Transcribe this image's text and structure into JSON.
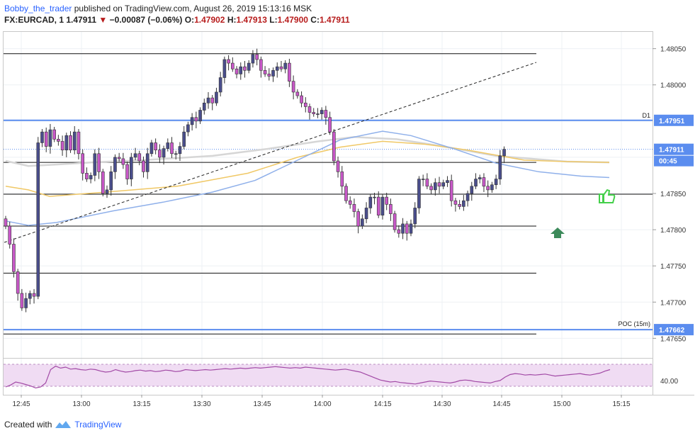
{
  "header": {
    "author": "Bobby_the_trader",
    "published": "published on TradingView.com, August 26, 2019 15:13:16 MSK",
    "symbol": "FX:EURCAD, 1",
    "price": "1.47911",
    "change": "−0.00087 (−0.06%)",
    "o_label": "O:",
    "o": "1.47902",
    "h_label": "H:",
    "h": "1.47913",
    "l_label": "L:",
    "l": "1.47900",
    "c_label": "C:",
    "c": "1.47911"
  },
  "footer": {
    "created_with": "Created with",
    "brand": "TradingView"
  },
  "price_axis": {
    "ticks": [
      "1.48050",
      "1.48000",
      "1.47850",
      "1.47800",
      "1.47750",
      "1.47700",
      "1.47650"
    ],
    "range": [
      1.4762,
      1.4808
    ]
  },
  "time_axis": {
    "ticks": [
      "12:45",
      "13:00",
      "13:15",
      "13:30",
      "13:45",
      "14:00",
      "14:15",
      "14:30",
      "14:45",
      "15:00",
      "15:15"
    ]
  },
  "tags": {
    "d1_label": "D1",
    "d1_value": "1.47951",
    "current_value": "1.47911",
    "countdown": "00:45",
    "poc_label": "POC (15m)",
    "poc_value": "1.47662"
  },
  "rsi": {
    "tick": "40.00"
  },
  "colors": {
    "bull": "#4a4e8c",
    "bear": "#c858c8",
    "blue_line": "#5b8def",
    "ma_blue": "#8fb0ea",
    "ma_yellow": "#f0c866",
    "ma_gray": "#d6d6d6",
    "rsi_line": "#a24aa6",
    "rsi_band": "#f0dcf3",
    "arrow": "#3c8a5a",
    "thumb": "#44d04a"
  },
  "chart_data": {
    "type": "candlestick",
    "symbol": "EURCAD",
    "interval": "1",
    "ylim": [
      1.4762,
      1.4808
    ],
    "horizontal_levels": [
      1.48043,
      1.47951,
      1.47893,
      1.47849,
      1.47805,
      1.4774,
      1.47662,
      1.47656
    ],
    "last_close": 1.47911,
    "annotations": [
      "D1 1.47951",
      "POC (15m) 1.47662"
    ]
  }
}
